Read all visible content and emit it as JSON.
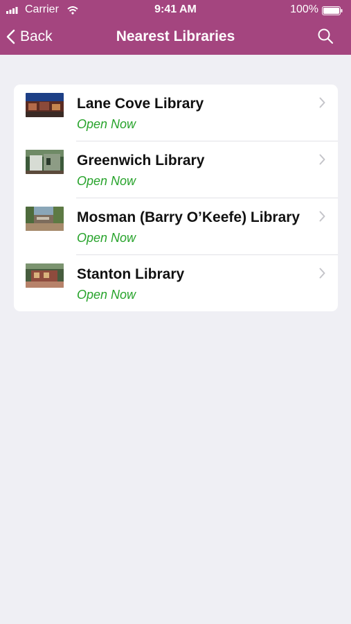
{
  "status_bar": {
    "carrier": "Carrier",
    "time": "9:41 AM",
    "battery": "100%"
  },
  "nav": {
    "back_label": "Back",
    "title": "Nearest Libraries"
  },
  "colors": {
    "header_bg": "#a4457f",
    "status_open": "#27a32b",
    "background": "#efeff4"
  },
  "libraries": [
    {
      "name": "Lane Cove Library",
      "status": "Open Now"
    },
    {
      "name": "Greenwich Library",
      "status": "Open Now"
    },
    {
      "name": "Mosman (Barry O’Keefe) Library",
      "status": "Open Now"
    },
    {
      "name": "Stanton Library",
      "status": "Open Now"
    }
  ]
}
